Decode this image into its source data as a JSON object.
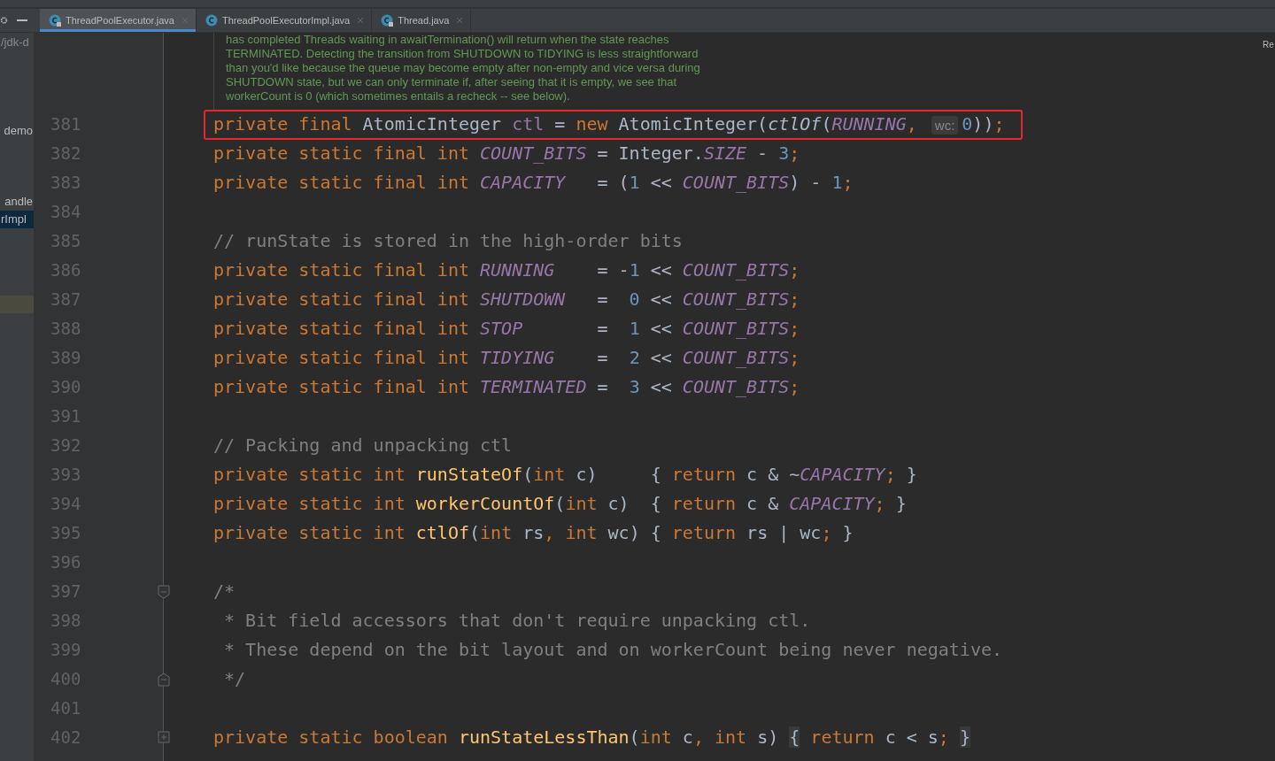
{
  "tabs": [
    {
      "label": "ThreadPoolExecutor.java",
      "selected": true,
      "locked": true
    },
    {
      "label": "ThreadPoolExecutorImpl.java",
      "selected": false,
      "locked": false
    },
    {
      "label": "Thread.java",
      "selected": false,
      "locked": true
    }
  ],
  "sidebar": {
    "items": [
      {
        "label": "/jdk-d",
        "selected": false
      },
      {
        "label": "demo",
        "selected": false
      },
      {
        "label": "andle",
        "selected": false
      },
      {
        "label": "rImpl",
        "selected": true
      }
    ]
  },
  "right_panel": {
    "label": "Re"
  },
  "doc_comment": [
    "has completed Threads waiting in awaitTermination() will return when the state reaches",
    "TERMINATED. Detecting the transition from SHUTDOWN to TIDYING is less straightforward",
    "than you'd like because the queue may become empty after non-empty and vice versa during",
    "SHUTDOWN state, but we can only terminate if, after seeing that it is empty, we see that",
    "workerCount is 0 (which sometimes entails a recheck -- see below)."
  ],
  "lines": [
    {
      "number": "381",
      "highlighted": true,
      "segments": [
        {
          "kind": "kw",
          "t": "private final "
        },
        {
          "kind": "plain",
          "t": "AtomicInteger "
        },
        {
          "kind": "ivar",
          "t": "ctl"
        },
        {
          "kind": "plain",
          "t": " = "
        },
        {
          "kind": "kw",
          "t": "new "
        },
        {
          "kind": "plain",
          "t": "AtomicInteger("
        },
        {
          "kind": "call",
          "t": "ctlOf"
        },
        {
          "kind": "plain",
          "t": "("
        },
        {
          "kind": "field",
          "t": "RUNNING"
        },
        {
          "kind": "kw",
          "t": ", "
        },
        {
          "kind": "hint",
          "t": "wc:"
        },
        {
          "kind": "num",
          "t": "0"
        },
        {
          "kind": "plain",
          "t": "))"
        },
        {
          "kind": "kw",
          "t": ";"
        }
      ]
    },
    {
      "number": "382",
      "highlighted": false,
      "segments": [
        {
          "kind": "kw",
          "t": "private static final int "
        },
        {
          "kind": "field",
          "t": "COUNT_BITS"
        },
        {
          "kind": "plain",
          "t": " = Integer."
        },
        {
          "kind": "field",
          "t": "SIZE"
        },
        {
          "kind": "plain",
          "t": " - "
        },
        {
          "kind": "num",
          "t": "3"
        },
        {
          "kind": "kw",
          "t": ";"
        }
      ]
    },
    {
      "number": "383",
      "highlighted": false,
      "segments": [
        {
          "kind": "kw",
          "t": "private static final int "
        },
        {
          "kind": "field",
          "t": "CAPACITY"
        },
        {
          "kind": "plain",
          "t": "   = ("
        },
        {
          "kind": "num",
          "t": "1"
        },
        {
          "kind": "plain",
          "t": " << "
        },
        {
          "kind": "field",
          "t": "COUNT_BITS"
        },
        {
          "kind": "plain",
          "t": ") - "
        },
        {
          "kind": "num",
          "t": "1"
        },
        {
          "kind": "kw",
          "t": ";"
        }
      ]
    },
    {
      "number": "384",
      "highlighted": false
    },
    {
      "number": "385",
      "highlighted": false,
      "segments": [
        {
          "kind": "cmt",
          "t": "// runState is stored in the high-order bits"
        }
      ]
    },
    {
      "number": "386",
      "highlighted": false,
      "segments": [
        {
          "kind": "kw",
          "t": "private static final int "
        },
        {
          "kind": "field",
          "t": "RUNNING"
        },
        {
          "kind": "plain",
          "t": "    = -"
        },
        {
          "kind": "num",
          "t": "1"
        },
        {
          "kind": "plain",
          "t": " << "
        },
        {
          "kind": "field",
          "t": "COUNT_BITS"
        },
        {
          "kind": "kw",
          "t": ";"
        }
      ]
    },
    {
      "number": "387",
      "highlighted": false,
      "segments": [
        {
          "kind": "kw",
          "t": "private static final int "
        },
        {
          "kind": "field",
          "t": "SHUTDOWN"
        },
        {
          "kind": "plain",
          "t": "   =  "
        },
        {
          "kind": "num",
          "t": "0"
        },
        {
          "kind": "plain",
          "t": " << "
        },
        {
          "kind": "field",
          "t": "COUNT_BITS"
        },
        {
          "kind": "kw",
          "t": ";"
        }
      ]
    },
    {
      "number": "388",
      "highlighted": false,
      "segments": [
        {
          "kind": "kw",
          "t": "private static final int "
        },
        {
          "kind": "field",
          "t": "STOP"
        },
        {
          "kind": "plain",
          "t": "       =  "
        },
        {
          "kind": "num",
          "t": "1"
        },
        {
          "kind": "plain",
          "t": " << "
        },
        {
          "kind": "field",
          "t": "COUNT_BITS"
        },
        {
          "kind": "kw",
          "t": ";"
        }
      ]
    },
    {
      "number": "389",
      "highlighted": false,
      "segments": [
        {
          "kind": "kw",
          "t": "private static final int "
        },
        {
          "kind": "field",
          "t": "TIDYING"
        },
        {
          "kind": "plain",
          "t": "    =  "
        },
        {
          "kind": "num",
          "t": "2"
        },
        {
          "kind": "plain",
          "t": " << "
        },
        {
          "kind": "field",
          "t": "COUNT_BITS"
        },
        {
          "kind": "kw",
          "t": ";"
        }
      ]
    },
    {
      "number": "390",
      "highlighted": false,
      "segments": [
        {
          "kind": "kw",
          "t": "private static final int "
        },
        {
          "kind": "field",
          "t": "TERMINATED"
        },
        {
          "kind": "plain",
          "t": " =  "
        },
        {
          "kind": "num",
          "t": "3"
        },
        {
          "kind": "plain",
          "t": " << "
        },
        {
          "kind": "field",
          "t": "COUNT_BITS"
        },
        {
          "kind": "kw",
          "t": ";"
        }
      ]
    },
    {
      "number": "391",
      "highlighted": false
    },
    {
      "number": "392",
      "highlighted": false,
      "segments": [
        {
          "kind": "cmt",
          "t": "// Packing and unpacking ctl"
        }
      ]
    },
    {
      "number": "393",
      "highlighted": false,
      "segments": [
        {
          "kind": "kw",
          "t": "private static int "
        },
        {
          "kind": "fn",
          "t": "runStateOf"
        },
        {
          "kind": "plain",
          "t": "("
        },
        {
          "kind": "kw",
          "t": "int "
        },
        {
          "kind": "plain",
          "t": "c)     { "
        },
        {
          "kind": "kw",
          "t": "return "
        },
        {
          "kind": "plain",
          "t": "c & ~"
        },
        {
          "kind": "field",
          "t": "CAPACITY"
        },
        {
          "kind": "kw",
          "t": ";"
        },
        {
          "kind": "plain",
          "t": " }"
        }
      ]
    },
    {
      "number": "394",
      "highlighted": false,
      "segments": [
        {
          "kind": "kw",
          "t": "private static int "
        },
        {
          "kind": "fn",
          "t": "workerCountOf"
        },
        {
          "kind": "plain",
          "t": "("
        },
        {
          "kind": "kw",
          "t": "int "
        },
        {
          "kind": "plain",
          "t": "c)  { "
        },
        {
          "kind": "kw",
          "t": "return "
        },
        {
          "kind": "plain",
          "t": "c & "
        },
        {
          "kind": "field",
          "t": "CAPACITY"
        },
        {
          "kind": "kw",
          "t": ";"
        },
        {
          "kind": "plain",
          "t": " }"
        }
      ]
    },
    {
      "number": "395",
      "highlighted": false,
      "segments": [
        {
          "kind": "kw",
          "t": "private static int "
        },
        {
          "kind": "fn",
          "t": "ctlOf"
        },
        {
          "kind": "plain",
          "t": "("
        },
        {
          "kind": "kw",
          "t": "int "
        },
        {
          "kind": "plain",
          "t": "rs"
        },
        {
          "kind": "kw",
          "t": ", int "
        },
        {
          "kind": "plain",
          "t": "wc) { "
        },
        {
          "kind": "kw",
          "t": "return "
        },
        {
          "kind": "plain",
          "t": "rs | wc"
        },
        {
          "kind": "kw",
          "t": ";"
        },
        {
          "kind": "plain",
          "t": " }"
        }
      ]
    },
    {
      "number": "396",
      "highlighted": false
    },
    {
      "number": "397",
      "highlighted": false,
      "fold_marker": {
        "kind": "start"
      },
      "segments": [
        {
          "kind": "cmt",
          "t": "/*"
        }
      ]
    },
    {
      "number": "398",
      "highlighted": false,
      "segments": [
        {
          "kind": "cmt",
          "t": " * Bit field accessors that don't require unpacking ctl."
        }
      ]
    },
    {
      "number": "399",
      "highlighted": false,
      "segments": [
        {
          "kind": "cmt",
          "t": " * These depend on the bit layout and on workerCount being never negative."
        }
      ]
    },
    {
      "number": "400",
      "highlighted": false,
      "fold_marker": {
        "kind": "end"
      },
      "segments": [
        {
          "kind": "cmt",
          "t": " */"
        }
      ]
    },
    {
      "number": "401",
      "highlighted": false
    },
    {
      "number": "402",
      "highlighted": false,
      "fold_marker": {
        "kind": "collapsed"
      },
      "segments": [
        {
          "kind": "kw",
          "t": "private static boolean "
        },
        {
          "kind": "fn",
          "t": "runStateLessThan"
        },
        {
          "kind": "plain",
          "t": "("
        },
        {
          "kind": "kw",
          "t": "int "
        },
        {
          "kind": "plain",
          "t": "c"
        },
        {
          "kind": "kw",
          "t": ", int "
        },
        {
          "kind": "plain",
          "t": "s) "
        },
        {
          "kind": "fold",
          "t": "{"
        },
        {
          "kind": "kw",
          "t": " return "
        },
        {
          "kind": "plain",
          "t": "c < s"
        },
        {
          "kind": "kw",
          "t": "; "
        },
        {
          "kind": "fold",
          "t": "}"
        }
      ]
    }
  ]
}
